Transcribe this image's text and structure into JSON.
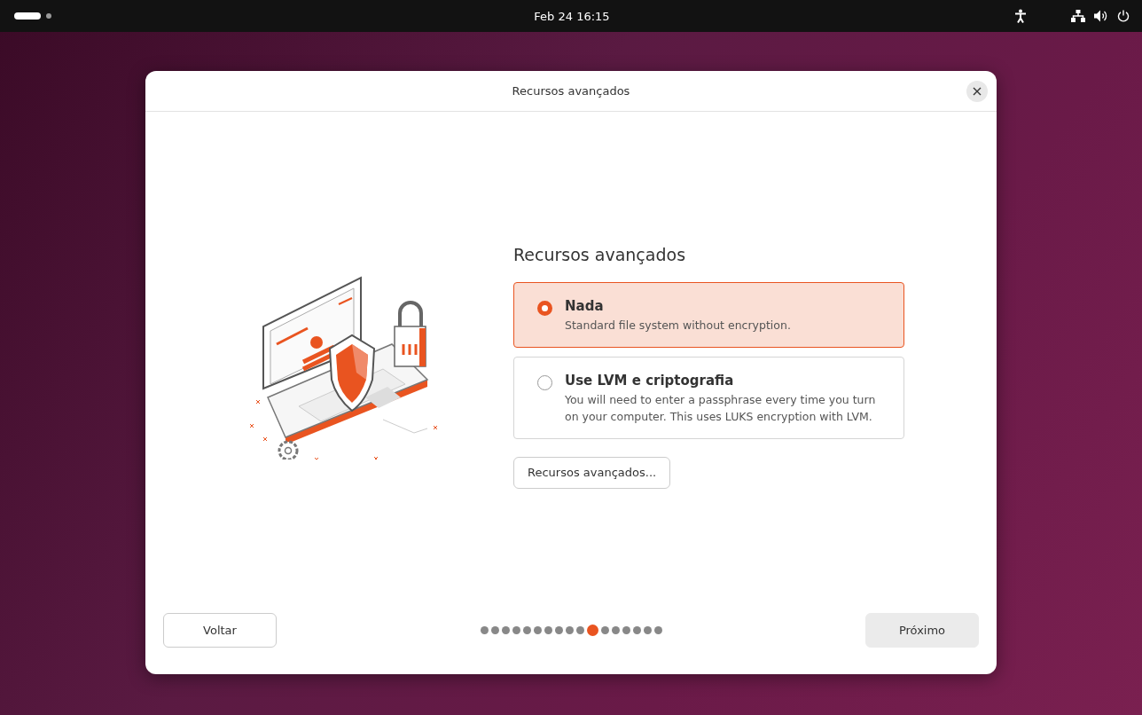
{
  "top_bar": {
    "clock": "Feb 24  16:15"
  },
  "dialog": {
    "title": "Recursos avançados",
    "heading": "Recursos avançados",
    "options": [
      {
        "label": "Nada",
        "description": "Standard file system without encryption.",
        "selected": true
      },
      {
        "label": "Use LVM e criptografia",
        "description": "You will need to enter a passphrase every time you turn on your computer. This uses LUKS encryption with LVM.",
        "selected": false
      }
    ],
    "advanced_button": "Recursos avançados...",
    "back_button": "Voltar",
    "next_button": "Próximo",
    "steps": [
      {
        "selected": false
      },
      {
        "selected": false
      },
      {
        "selected": false
      },
      {
        "selected": false
      },
      {
        "selected": false
      },
      {
        "selected": false
      },
      {
        "selected": false
      },
      {
        "selected": false
      },
      {
        "selected": false
      },
      {
        "selected": false
      },
      {
        "selected": true
      },
      {
        "selected": false
      },
      {
        "selected": false
      },
      {
        "selected": false
      },
      {
        "selected": false
      },
      {
        "selected": false
      },
      {
        "selected": false
      }
    ]
  }
}
